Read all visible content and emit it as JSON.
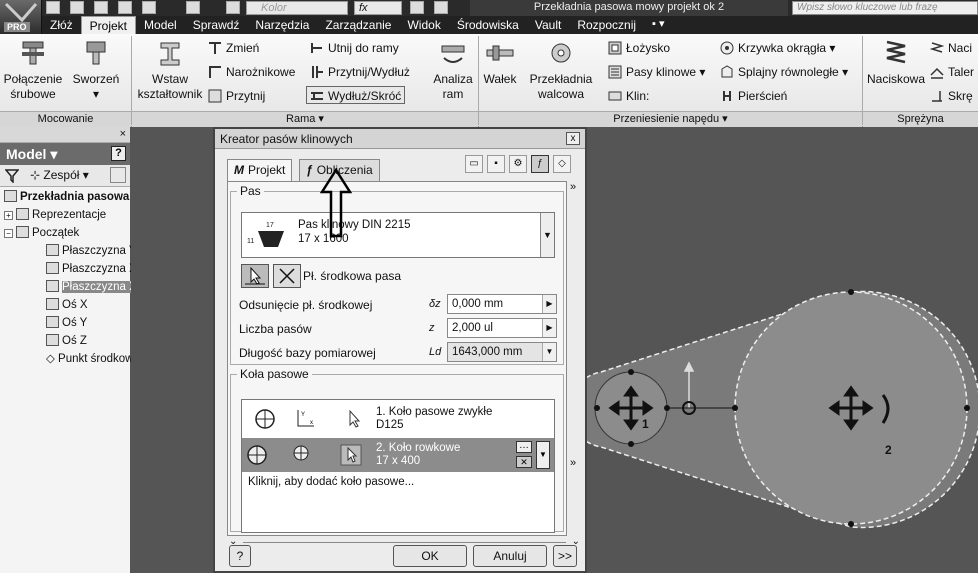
{
  "titlebar": {
    "pro_badge": "PRO",
    "color_field_placeholder": "Kolor",
    "fx_label": "fx",
    "document_title": "Przekładnia pasowa mowy projekt ok 2",
    "search_placeholder": "Wpisz słowo kluczowe lub frazę"
  },
  "ribbon_tabs": [
    "Złóż",
    "Projekt",
    "Model",
    "Sprawdź",
    "Narzędzia",
    "Zarządzanie",
    "Widok",
    "Środowiska",
    "Vault",
    "Rozpocznij"
  ],
  "ribbon_tab_extra": "▪ ▾",
  "ribbon": {
    "mocowanie": {
      "title": "Mocowanie",
      "polaczenie_line1": "Połączenie",
      "polaczenie_line2": "śrubowe",
      "sworzen": "Sworzeń"
    },
    "rama": {
      "title": "Rama ▾",
      "wstaw_line1": "Wstaw",
      "wstaw_line2": "kształtownik",
      "zmien": "Zmień",
      "naroznikowe": "Narożnikowe",
      "przytnij": "Przytnij",
      "utnij": "Utnij do ramy",
      "przytnij_wydluz": "Przytnij/Wydłuż",
      "wydluz_skroc": "Wydłuż/Skróć",
      "analiza_line1": "Analiza",
      "analiza_line2": "ram"
    },
    "naped": {
      "title": "Przeniesienie napędu ▾",
      "walek": "Wałek",
      "przekladnia_line1": "Przekładnia",
      "przekladnia_line2": "walcowa",
      "lozysko": "Łożysko",
      "pasy": "Pasy klinowe",
      "klin": "Klin:",
      "krzywka": "Krzywka okrągła",
      "splajny": "Splajny równoległe",
      "pierscien": "Pierścień"
    },
    "sprezyna": {
      "title": "Sprężyna",
      "naciskowa": "Naciskowa",
      "naci": "Naci",
      "taler": "Taler",
      "skre": "Skrę"
    }
  },
  "browser": {
    "close": "×",
    "header": "Model ▾",
    "help": "?",
    "assembly_label": "Zespół",
    "tree": [
      {
        "label": "Przekładnia pasowa",
        "bold": true
      },
      {
        "label": "Reprezentacje"
      },
      {
        "label": "Początek"
      },
      {
        "label": "Płaszczyzna Y"
      },
      {
        "label": "Płaszczyzna X"
      },
      {
        "label": "Płaszczyzna X",
        "selected": true
      },
      {
        "label": "Oś X"
      },
      {
        "label": "Oś Y"
      },
      {
        "label": "Oś Z"
      },
      {
        "label": "Punkt środkowy"
      }
    ]
  },
  "canvas": {
    "pulley1_label": "1",
    "pulley2_label": "2"
  },
  "dialog": {
    "title": "Kreator pasów klinowych",
    "close": "x",
    "tab_projekt": "Projekt",
    "tab_obliczenia": "Obliczenia",
    "pas_legend": "Pas",
    "belt_dim_top": "17",
    "belt_dim_side": "11",
    "belt_name": "Pas klinowy DIN 2215",
    "belt_size": "17 x 1600",
    "mid_plane_label": "Pł. środkowa pasa",
    "params": [
      {
        "label": "Odsunięcie pł. środkowej",
        "symbol": "δz",
        "value": "0,000 mm"
      },
      {
        "label": "Liczba pasów",
        "symbol": "z",
        "value": "2,000 ul"
      },
      {
        "label": "Długość bazy pomiarowej",
        "symbol": "Ld",
        "value": "1643,000 mm"
      }
    ],
    "kola_legend": "Koła pasowe",
    "kola": [
      {
        "line1": "1. Koło pasowe zwykłe",
        "line2": "D125"
      },
      {
        "line1": "2. Koło rowkowe",
        "line2": "17 x 400"
      }
    ],
    "add_kolo": "Kliknij, aby dodać koło pasowe...",
    "ok": "OK",
    "cancel": "Anuluj",
    "more": ">>",
    "help": "?"
  }
}
